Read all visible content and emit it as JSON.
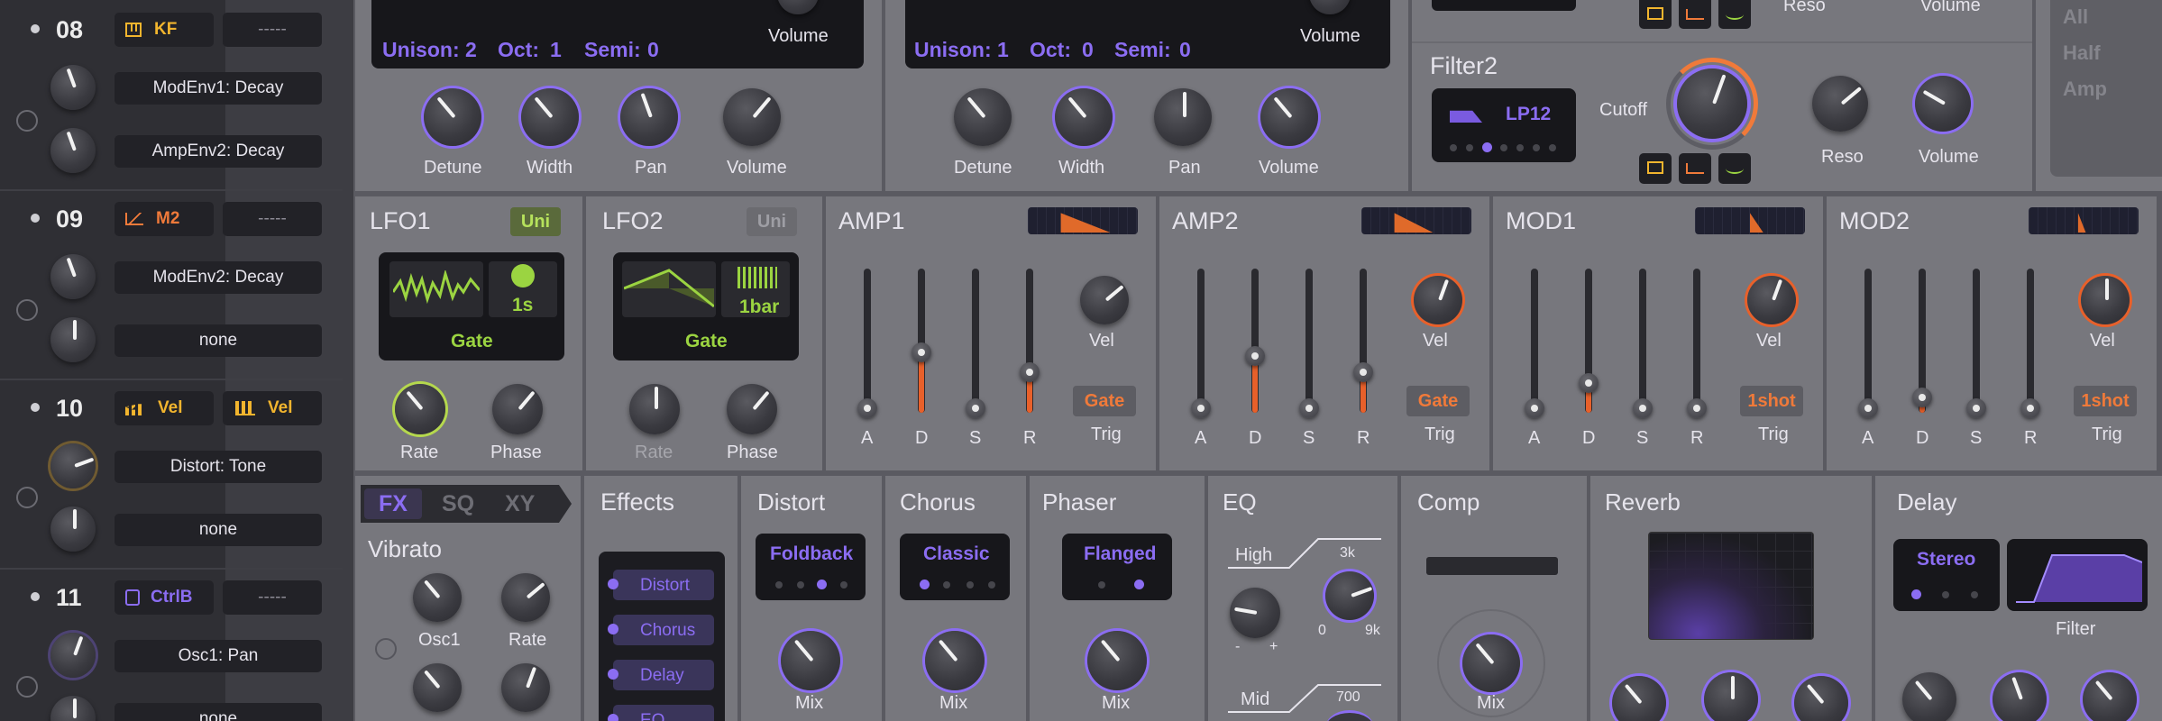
{
  "sidebar": {
    "rows": [
      {
        "num": "08",
        "src1": "KF",
        "src2": "-----",
        "t1": "ModEnv1: Decay",
        "t2": "AmpEnv2: Decay"
      },
      {
        "num": "09",
        "src1": "M2",
        "src2": "-----",
        "t1": "ModEnv2: Decay",
        "t2": "none"
      },
      {
        "num": "10",
        "src1": "Vel",
        "src2": "Vel",
        "t1": "Distort: Tone",
        "t2": "none"
      },
      {
        "num": "11",
        "src1": "CtrlB",
        "src2": "-----",
        "t1": "Osc1: Pan",
        "t2": "none"
      }
    ]
  },
  "osc1": {
    "unison": "Unison: 2",
    "oct": "Oct:",
    "oct_val": "1",
    "semi": "Semi:",
    "semi_val": "0",
    "volume": "Volume",
    "knobs": [
      "Detune",
      "Width",
      "Pan",
      "Volume"
    ]
  },
  "osc2": {
    "unison": "Unison: 1",
    "oct": "Oct:",
    "oct_val": "0",
    "semi": "Semi:",
    "semi_val": "0",
    "volume": "Volume",
    "knobs": [
      "Detune",
      "Width",
      "Pan",
      "Volume"
    ]
  },
  "filter1": {
    "reso": "Reso",
    "volume": "Volume"
  },
  "filter2": {
    "title": "Filter2",
    "type": "LP12",
    "cutoff": "Cutoff",
    "reso": "Reso",
    "volume": "Volume"
  },
  "mode": {
    "items": [
      "All",
      "Half",
      "Amp"
    ]
  },
  "lfo1": {
    "title": "LFO1",
    "badge": "Uni",
    "time": "1s",
    "mode": "Gate",
    "rate": "Rate",
    "phase": "Phase"
  },
  "lfo2": {
    "title": "LFO2",
    "badge": "Uni",
    "time": "1bar",
    "mode": "Gate",
    "rate": "Rate",
    "phase": "Phase"
  },
  "envs": [
    {
      "title": "AMP1",
      "trig": "Gate",
      "vel": "Vel",
      "trig_label": "Trig"
    },
    {
      "title": "AMP2",
      "trig": "Gate",
      "vel": "Vel",
      "trig_label": "Trig"
    },
    {
      "title": "MOD1",
      "trig": "1shot",
      "vel": "Vel",
      "trig_label": "Trig"
    },
    {
      "title": "MOD2",
      "trig": "1shot",
      "vel": "Vel",
      "trig_label": "Trig"
    }
  ],
  "adsr": [
    "A",
    "D",
    "S",
    "R"
  ],
  "fx_tabs": [
    "FX",
    "SQ",
    "XY"
  ],
  "vibrato": {
    "title": "Vibrato",
    "osc1": "Osc1",
    "rate": "Rate"
  },
  "effects": {
    "title": "Effects",
    "items": [
      "Distort",
      "Chorus",
      "Delay",
      "EQ"
    ]
  },
  "distort": {
    "title": "Distort",
    "mode": "Foldback",
    "mix": "Mix"
  },
  "chorus": {
    "title": "Chorus",
    "mode": "Classic",
    "mix": "Mix"
  },
  "phaser": {
    "title": "Phaser",
    "mode": "Flanged",
    "mix": "Mix"
  },
  "eq": {
    "title": "EQ",
    "high": "High",
    "high_freq": "3k",
    "min": "0",
    "max": "9k",
    "minus": "-",
    "plus": "+",
    "mid": "Mid",
    "mid_freq": "700"
  },
  "comp": {
    "title": "Comp",
    "mix": "Mix"
  },
  "reverb": {
    "title": "Reverb"
  },
  "delay": {
    "title": "Delay",
    "mode": "Stereo",
    "filter": "Filter"
  },
  "colors": {
    "accent": "#8b6df2",
    "orange": "#f07a3a",
    "yellow": "#f2b52e",
    "green": "#9bd441"
  }
}
